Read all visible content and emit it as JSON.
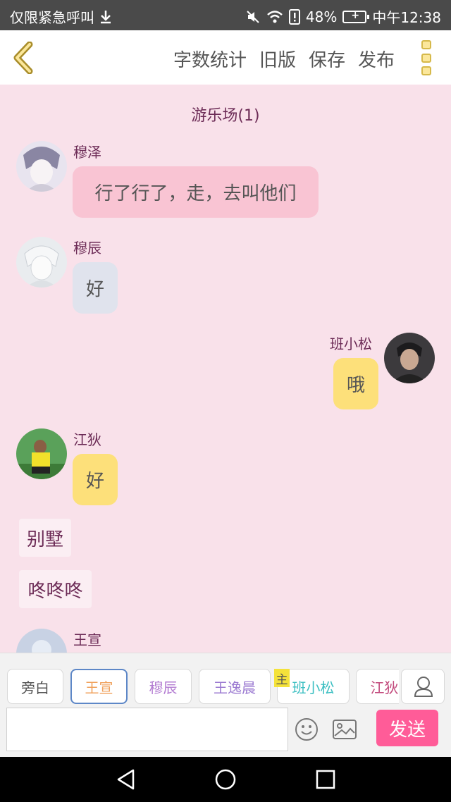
{
  "status_bar": {
    "carrier": "仅限紧急呼叫",
    "battery": "48%",
    "time": "中午12:38"
  },
  "top_bar": {
    "actions": [
      "字数统计",
      "旧版",
      "保存",
      "发布"
    ]
  },
  "chat": {
    "title": "游乐场(1)",
    "messages": [
      {
        "name": "穆泽",
        "text": "行了行了，走，去叫他们",
        "side": "left",
        "color": "#f9c4d3"
      },
      {
        "name": "穆辰",
        "text": "好",
        "side": "left",
        "color": "#e0e3ed"
      },
      {
        "name": "班小松",
        "text": "哦",
        "side": "right",
        "color": "#fde07a"
      },
      {
        "name": "江狄",
        "text": "好",
        "side": "left",
        "color": "#fde07a"
      }
    ],
    "narrations": [
      "别墅",
      "咚咚咚"
    ],
    "pending_name": "王宣"
  },
  "roles": [
    {
      "label": "旁白",
      "color": "#555555"
    },
    {
      "label": "王宣",
      "color": "#f0a15b"
    },
    {
      "label": "穆辰",
      "color": "#b27ad1"
    },
    {
      "label": "王逸晨",
      "color": "#9b7ad1"
    },
    {
      "label": "班小松",
      "color": "#3bbfc2"
    },
    {
      "label": "江狄",
      "color": "#c24a7c"
    }
  ],
  "host_tag": "主",
  "input": {
    "value": "",
    "placeholder": ""
  },
  "send_label": "发送",
  "colors": {
    "accent": "#ff5c98",
    "background": "#f9e1ea",
    "name_text": "#6c2b56"
  }
}
